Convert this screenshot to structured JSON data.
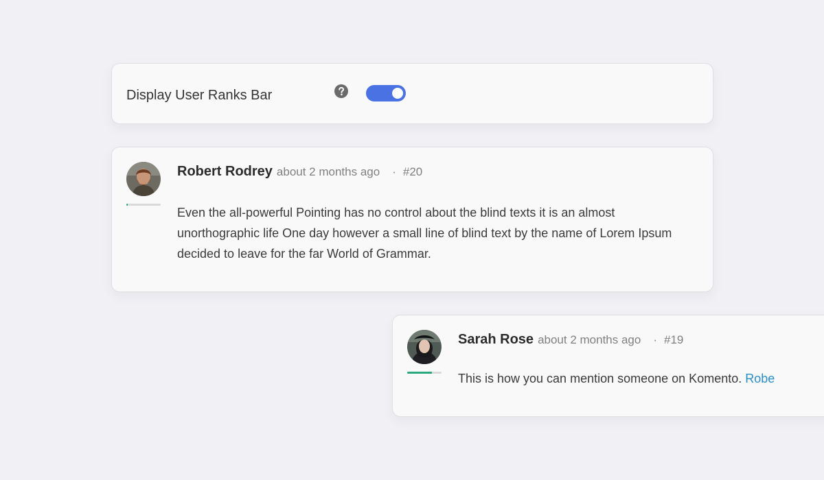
{
  "settings": {
    "label": "Display User Ranks Bar",
    "help_icon": "question-circle-icon",
    "toggle_on": true,
    "toggle_color": "#4a72e3"
  },
  "comments": [
    {
      "author": "Robert Rodrey",
      "time": "about 2 months ago",
      "separator": "·",
      "number": "#20",
      "body": "Even the all-powerful Pointing has no control about the blind texts it is an almost unorthographic life One day however a small line of blind text by the name of Lorem Ipsum decided to leave for the far World of Grammar.",
      "rank_progress": 0.04,
      "rank_color": "#2ca87f"
    },
    {
      "author": "Sarah Rose",
      "time": "about 2 months ago",
      "separator": "·",
      "number": "#19",
      "body": "This is how you can mention someone on Komento.",
      "mention": "Robe",
      "rank_progress": 0.72,
      "rank_color": "#2ca87f"
    }
  ]
}
